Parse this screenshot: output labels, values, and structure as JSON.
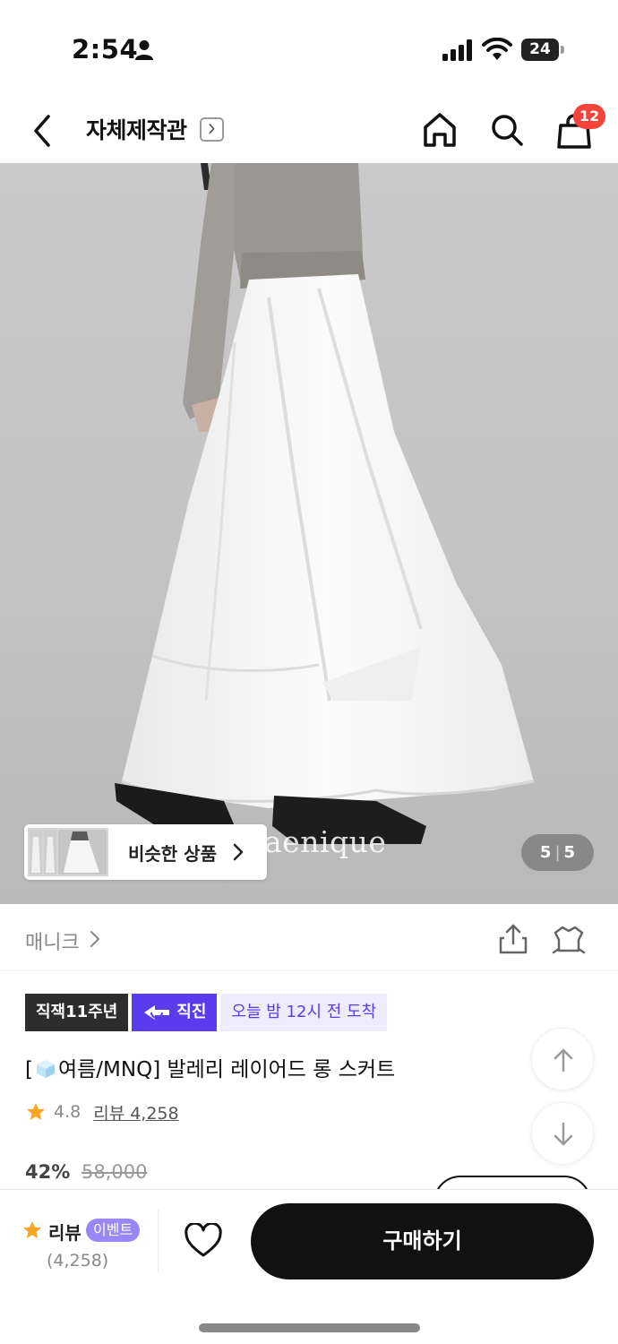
{
  "status_bar": {
    "time": "2:54",
    "battery": "24"
  },
  "nav": {
    "title": "자체제작관",
    "cart_count": "12"
  },
  "hero": {
    "watermark": "aenique",
    "similar_label": "비슷한 상품",
    "page_current": "5",
    "page_total": "5"
  },
  "brand": {
    "name": "매니크"
  },
  "tags": {
    "anniversary": "직잭11주년",
    "direct": "직진",
    "delivery": "오늘 밤 12시 전 도착"
  },
  "product": {
    "name_prefix": "[",
    "name_rest": "여름/MNQ] 발레리 레이어드 롱 스커트",
    "rating": "4.8",
    "review_link": "리뷰 4,258",
    "discount": "42%",
    "original_price": "58,000"
  },
  "bottom_bar": {
    "review_label": "리뷰",
    "event_badge": "이벤트",
    "review_count": "(4,258)",
    "buy_label": "구매하기"
  },
  "colors": {
    "accent_purple": "#5b3bf0",
    "badge_red": "#f3433b",
    "star": "#f5a623"
  }
}
